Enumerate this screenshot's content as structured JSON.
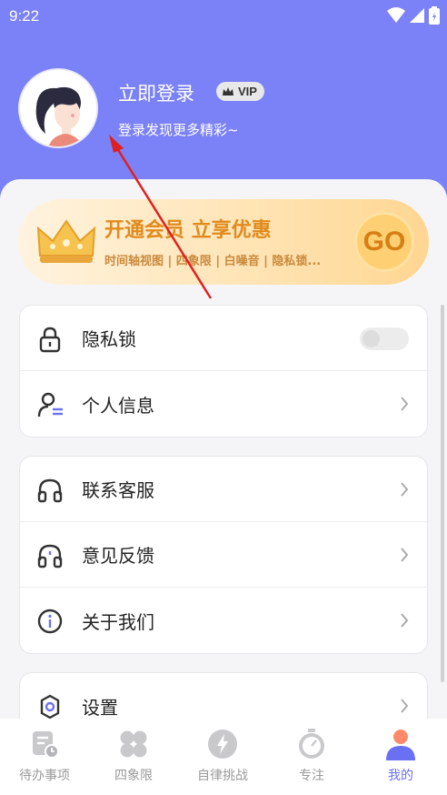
{
  "status_bar": {
    "time": "9:22",
    "icons": [
      "wifi-icon",
      "signal-icon",
      "battery-icon"
    ]
  },
  "profile": {
    "login_title": "立即登录",
    "vip_label": "VIP",
    "login_subtitle": "登录发现更多精彩~"
  },
  "promo": {
    "title": "开通会员 立享优惠",
    "subtitle": "时间轴视图 | 四象限 | 白噪音 | 隐私锁...",
    "go_label": "GO"
  },
  "menu": {
    "group1": [
      {
        "label": "隐私锁",
        "icon": "lock-icon",
        "control": "toggle",
        "toggle_on": false
      },
      {
        "label": "个人信息",
        "icon": "user-info-icon",
        "control": "chevron"
      }
    ],
    "group2": [
      {
        "label": "联系客服",
        "icon": "headset-icon",
        "control": "chevron"
      },
      {
        "label": "意见反馈",
        "icon": "feedback-headset-icon",
        "control": "chevron"
      },
      {
        "label": "关于我们",
        "icon": "info-icon",
        "control": "chevron"
      }
    ],
    "group3": [
      {
        "label": "设置",
        "icon": "settings-icon",
        "control": "chevron"
      }
    ]
  },
  "tabbar": {
    "tabs": [
      {
        "label": "待办事项",
        "icon": "todo-icon",
        "active": false
      },
      {
        "label": "四象限",
        "icon": "quadrant-icon",
        "active": false
      },
      {
        "label": "自律挑战",
        "icon": "lightning-icon",
        "active": false
      },
      {
        "label": "专注",
        "icon": "stopwatch-icon",
        "active": false
      },
      {
        "label": "我的",
        "icon": "profile-icon",
        "active": true
      }
    ]
  },
  "colors": {
    "header": "#7b81f6",
    "accent": "#6a70f2",
    "promo_text": "#e08a1c",
    "annotation_arrow": "#e02020"
  }
}
